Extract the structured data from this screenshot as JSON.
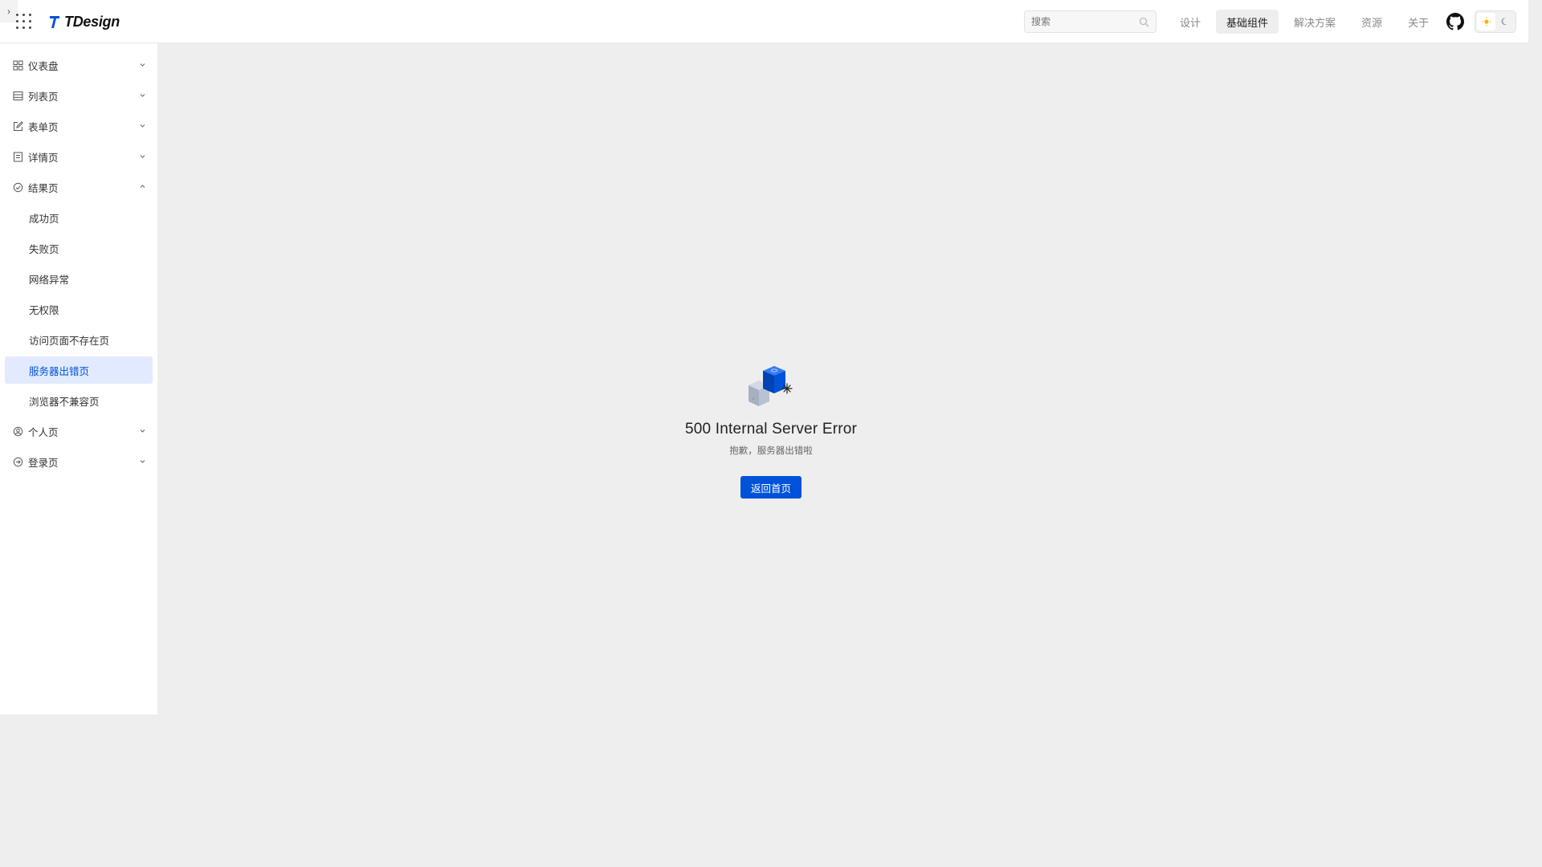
{
  "brand": {
    "name": "TDesign"
  },
  "header": {
    "search_placeholder": "搜索",
    "nav": [
      {
        "label": "设计",
        "active": false
      },
      {
        "label": "基础组件",
        "active": true
      },
      {
        "label": "解决方案",
        "active": false
      },
      {
        "label": "资源",
        "active": false
      },
      {
        "label": "关于",
        "active": false
      }
    ]
  },
  "sidebar": {
    "items": [
      {
        "label": "仪表盘",
        "icon": "dashboard-icon",
        "expanded": false
      },
      {
        "label": "列表页",
        "icon": "list-icon",
        "expanded": false
      },
      {
        "label": "表单页",
        "icon": "form-edit-icon",
        "expanded": false
      },
      {
        "label": "详情页",
        "icon": "detail-icon",
        "expanded": false
      },
      {
        "label": "结果页",
        "icon": "check-circle-icon",
        "expanded": true,
        "children": [
          {
            "label": "成功页",
            "active": false
          },
          {
            "label": "失败页",
            "active": false
          },
          {
            "label": "网络异常",
            "active": false
          },
          {
            "label": "无权限",
            "active": false
          },
          {
            "label": "访问页面不存在页",
            "active": false
          },
          {
            "label": "服务器出错页",
            "active": true
          },
          {
            "label": "浏览器不兼容页",
            "active": false
          }
        ]
      },
      {
        "label": "个人页",
        "icon": "user-circle-icon",
        "expanded": false
      },
      {
        "label": "登录页",
        "icon": "login-icon",
        "expanded": false
      }
    ]
  },
  "result": {
    "title": "500 Internal Server Error",
    "description": "抱歉，服务器出错啦",
    "button_label": "返回首页"
  },
  "colors": {
    "primary": "#0052d9",
    "active_menu_bg": "#e2eaff",
    "page_bg": "#eeeeee"
  }
}
